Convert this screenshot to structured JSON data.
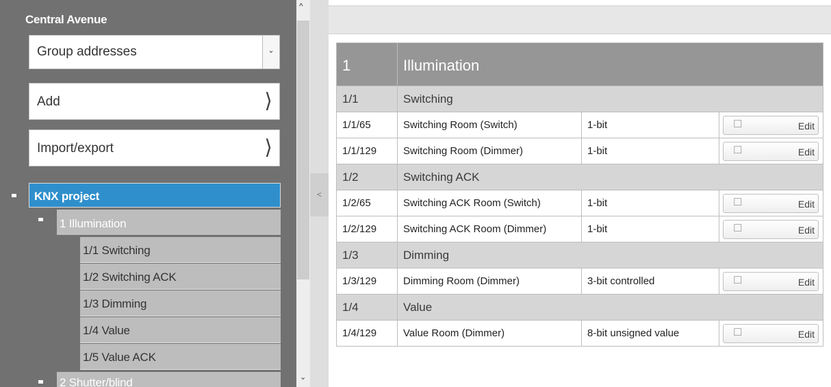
{
  "sidebar": {
    "title": "Central Avenue",
    "view_select": {
      "value": "Group addresses"
    },
    "add_label": "Add",
    "import_label": "Import/export",
    "tree": {
      "root": "KNX project",
      "group_1": "1 Illumination",
      "group_1_children": [
        "1/1 Switching",
        "1/2 Switching ACK",
        "1/3 Dimming",
        "1/4 Value",
        "1/5 Value ACK"
      ],
      "group_2": "2 Shutter/blind"
    }
  },
  "table": {
    "main_group": {
      "id": "1",
      "name": "Illumination"
    },
    "middle_groups": [
      {
        "id": "1/1",
        "name": "Switching",
        "rows": [
          {
            "address": "1/1/65",
            "name": "Switching Room (Switch)",
            "type": "1-bit",
            "edit": "Edit"
          },
          {
            "address": "1/1/129",
            "name": "Switching Room (Dimmer)",
            "type": "1-bit",
            "edit": "Edit"
          }
        ]
      },
      {
        "id": "1/2",
        "name": "Switching ACK",
        "rows": [
          {
            "address": "1/2/65",
            "name": "Switching ACK Room (Switch)",
            "type": "1-bit",
            "edit": "Edit"
          },
          {
            "address": "1/2/129",
            "name": "Switching ACK Room (Dimmer)",
            "type": "1-bit",
            "edit": "Edit"
          }
        ]
      },
      {
        "id": "1/3",
        "name": "Dimming",
        "rows": [
          {
            "address": "1/3/129",
            "name": "Dimming Room (Dimmer)",
            "type": "3-bit controlled",
            "edit": "Edit"
          }
        ]
      },
      {
        "id": "1/4",
        "name": "Value",
        "rows": [
          {
            "address": "1/4/129",
            "name": "Value Room (Dimmer)",
            "type": "8-bit unsigned value",
            "edit": "Edit"
          }
        ]
      }
    ]
  },
  "colors": {
    "sidebar_bg": "#717171",
    "selected_item": "#2f8fcc",
    "main_group_header": "#969696",
    "middle_group_header": "#d6d6d6"
  },
  "icons": {
    "select_arrow": "chevron-down-icon",
    "nav_arrow": "chevron-right-icon",
    "tree_toggle": "collapse-icon",
    "edit": "pencil-icon"
  }
}
